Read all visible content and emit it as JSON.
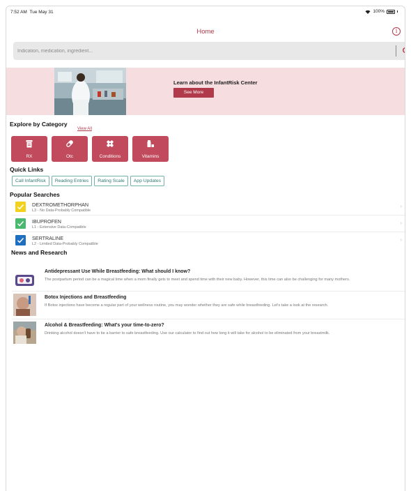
{
  "status_bar": {
    "time": "7:52 AM",
    "date": "Tue May 31",
    "battery": "100%"
  },
  "nav": {
    "title": "Home",
    "info_icon": "info-icon"
  },
  "search": {
    "placeholder": "Indication, medication, ingredient...",
    "value": "",
    "icon": "search-icon"
  },
  "banner": {
    "title": "Learn about the InfantRisk Center",
    "button": "See More"
  },
  "categories": {
    "title": "Explore by Category",
    "view_all": "View All",
    "items": [
      {
        "label": "RX",
        "icon": "prescription-icon"
      },
      {
        "label": "Otc",
        "icon": "pill-icon"
      },
      {
        "label": "Conditions",
        "icon": "bandage-icon"
      },
      {
        "label": "Vitamins",
        "icon": "vitamin-bottle-icon"
      }
    ]
  },
  "quick_links": {
    "title": "Quick Links",
    "items": [
      "Call InfantRisk",
      "Reading Entries",
      "Rating Scale",
      "App Updates"
    ]
  },
  "popular": {
    "title": "Popular Searches",
    "items": [
      {
        "name": "DEXTROMETHORPHAN",
        "desc": "L3 - No Data-Probably Compatible",
        "color": "#f2d21f"
      },
      {
        "name": "IBUPROFEN",
        "desc": "L1 - Extensive Data-Compatible",
        "color": "#49b96f"
      },
      {
        "name": "SERTRALINE",
        "desc": "L2 - Limited Data-Probably Compatible",
        "color": "#1f6fc0"
      }
    ]
  },
  "news": {
    "title": "News and Research",
    "items": [
      {
        "title": "Antidepressant Use While Breastfeeding: What should I know?",
        "desc": "The postpartum period can be a magical time when a mom finally gets to meet and spend time with their new baby. However, this time can also be challenging for many mothers."
      },
      {
        "title": "Botox Injections and Breastfeeding",
        "desc": "If Botox injections have become a regular part of your wellness routine, you may wonder whether they are safe while breastfeeding. Let's take a look at the research."
      },
      {
        "title": "Alcohol & Breastfeeding: What's your time-to-zero?",
        "desc": "Drinking alcohol doesn't have to be a barrier to safe breastfeeding. Use our calculator to find out how long it will take for alcohol to be eliminated from your breastmilk."
      }
    ]
  },
  "colors": {
    "accent": "#b03a4a",
    "category_bg": "#c14a5c",
    "banner_bg": "#f6dde0",
    "link_teal": "#2f7a70"
  }
}
